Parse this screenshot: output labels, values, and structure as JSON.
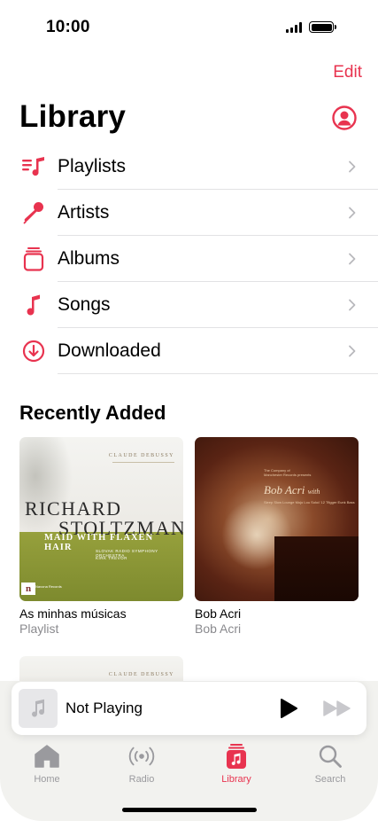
{
  "status_bar": {
    "time": "10:00"
  },
  "header": {
    "edit_label": "Edit",
    "title": "Library"
  },
  "menu": [
    {
      "label": "Playlists",
      "icon": "playlists-icon"
    },
    {
      "label": "Artists",
      "icon": "microphone-icon"
    },
    {
      "label": "Albums",
      "icon": "albums-icon"
    },
    {
      "label": "Songs",
      "icon": "music-note-icon"
    },
    {
      "label": "Downloaded",
      "icon": "download-icon"
    }
  ],
  "recently_added": {
    "title": "Recently Added",
    "items": [
      {
        "title": "As minhas músicas",
        "subtitle": "Playlist",
        "art": {
          "composer": "CLAUDE DEBUSSY",
          "name_line1": "RICHARD",
          "name_line2": "STOLTZMAN",
          "album": "MAID WITH FLAXEN HAIR",
          "orchestra": "SLOVAK RADIO SYMPHONY ORCHESTRA",
          "conductor": "KIRK TREVOR",
          "logo": "n",
          "logo_text": "Navona Records"
        }
      },
      {
        "title": "Bob Acri",
        "subtitle": "Bob Acri",
        "art": {
          "small_line1": "The Company of",
          "small_line2": "Manchester Records presents",
          "name": "Bob Acri",
          "name_suffix": "with",
          "tracks": "Sleep Slow Lounge Mojo Lou Solo// 12 Tfigger Eunk Bass"
        }
      }
    ],
    "partial_item": {
      "composer": "CLAUDE DEBUSSY"
    }
  },
  "mini_player": {
    "title": "Not Playing"
  },
  "tabs": [
    {
      "label": "Home",
      "active": false
    },
    {
      "label": "Radio",
      "active": false
    },
    {
      "label": "Library",
      "active": true
    },
    {
      "label": "Search",
      "active": false
    }
  ],
  "colors": {
    "accent": "#e8334f",
    "inactive": "#9a9a9e"
  }
}
